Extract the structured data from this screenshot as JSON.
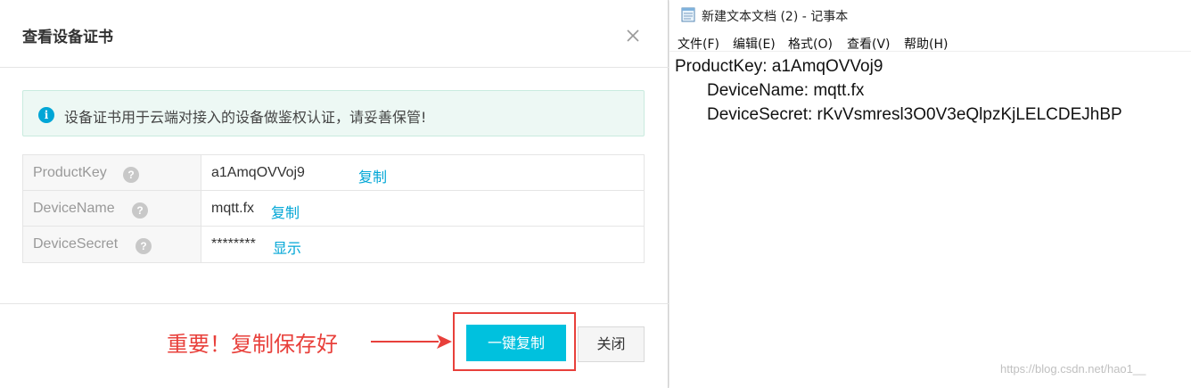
{
  "dialog": {
    "title": "查看设备证书",
    "close_icon": "close-icon",
    "info": {
      "icon": "info-icon",
      "icon_glyph": "i",
      "text": "设备证书用于云端对接入的设备做鉴权认证，请妥善保管!"
    },
    "fields": [
      {
        "key": "ProductKey",
        "value": "a1AmqOVVoj9",
        "action": "复制"
      },
      {
        "key": "DeviceName",
        "value": "mqtt.fx",
        "action": "复制"
      },
      {
        "key": "DeviceSecret",
        "value": "********",
        "action": "显示"
      }
    ],
    "help_glyph": "?",
    "annotation": "重要！复制保存好",
    "buttons": {
      "copy_all": "一键复制",
      "close": "关闭"
    },
    "colors": {
      "accent": "#00c1de",
      "link": "#00a6d6",
      "annotation": "#e8403b"
    }
  },
  "notepad": {
    "title": "新建文本文档 (2) - 记事本",
    "menu": [
      "文件(F)",
      "编辑(E)",
      "格式(O)",
      "查看(V)",
      "帮助(H)"
    ],
    "lines": [
      "ProductKey: a1AmqOVVoj9",
      "DeviceName: mqtt.fx",
      "DeviceSecret: rKvVsmresl3O0V3eQlpzKjLELCDEJhBP"
    ]
  },
  "watermark": "https://blog.csdn.net/hao1__"
}
